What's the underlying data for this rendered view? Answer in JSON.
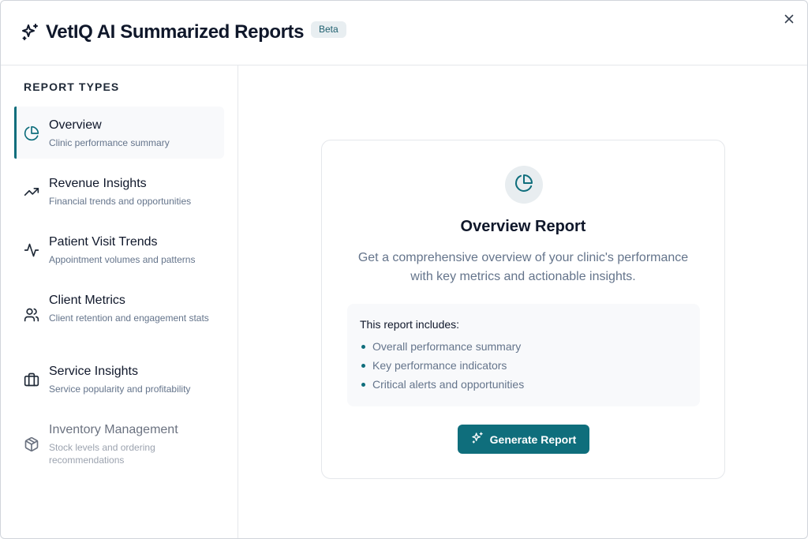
{
  "header": {
    "title": "VetIQ AI Summarized Reports",
    "badge": "Beta",
    "icon": "sparkles-icon",
    "close_icon": "close-icon"
  },
  "sidebar": {
    "heading": "REPORT TYPES",
    "items": [
      {
        "title": "Overview",
        "subtitle": "Clinic performance summary",
        "icon": "pie-chart-icon",
        "active": true
      },
      {
        "title": "Revenue Insights",
        "subtitle": "Financial trends and opportunities",
        "icon": "trending-up-icon"
      },
      {
        "title": "Patient Visit Trends",
        "subtitle": "Appointment volumes and patterns",
        "icon": "activity-icon"
      },
      {
        "title": "Client Metrics",
        "subtitle": "Client retention and engagement stats",
        "icon": "users-icon"
      },
      {
        "title": "Service Insights",
        "subtitle": "Service popularity and profitability",
        "icon": "briefcase-icon"
      },
      {
        "title": "Inventory Management",
        "subtitle": "Stock levels and ordering recommendations",
        "icon": "package-icon",
        "disabled": true
      }
    ]
  },
  "main": {
    "icon": "pie-chart-icon",
    "title": "Overview Report",
    "description": "Get a comprehensive overview of your clinic's performance with key metrics and actionable insights.",
    "includes_heading": "This report includes:",
    "includes": [
      "Overall performance summary",
      "Key performance indicators",
      "Critical alerts and opportunities"
    ],
    "generate_label": "Generate Report"
  },
  "colors": {
    "accent": "#0f6e7c",
    "badge_bg": "#e8eef1"
  }
}
